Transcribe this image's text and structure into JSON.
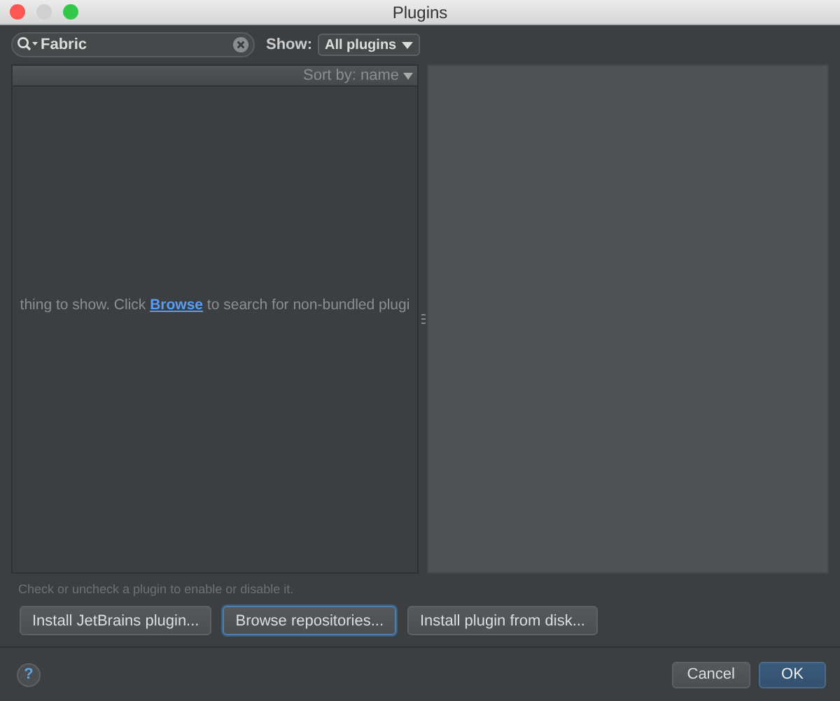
{
  "window": {
    "title": "Plugins"
  },
  "search": {
    "value": "Fabric"
  },
  "show": {
    "label": "Show:",
    "value": "All plugins"
  },
  "list": {
    "sort": "Sort by: name",
    "empty_text": {
      "before": "thing to show. Click ",
      "link": "Browse",
      "after": " to search for non-bundled plugi"
    }
  },
  "hint": "Check or uncheck a plugin to enable or disable it.",
  "actions": [
    {
      "label": "Install JetBrains plugin...",
      "focused": false
    },
    {
      "label": "Browse repositories...",
      "focused": true
    },
    {
      "label": "Install plugin from disk...",
      "focused": false
    }
  ],
  "help": "?",
  "buttons": [
    {
      "label": "Cancel",
      "default": false
    },
    {
      "label": "OK",
      "default": true
    }
  ]
}
